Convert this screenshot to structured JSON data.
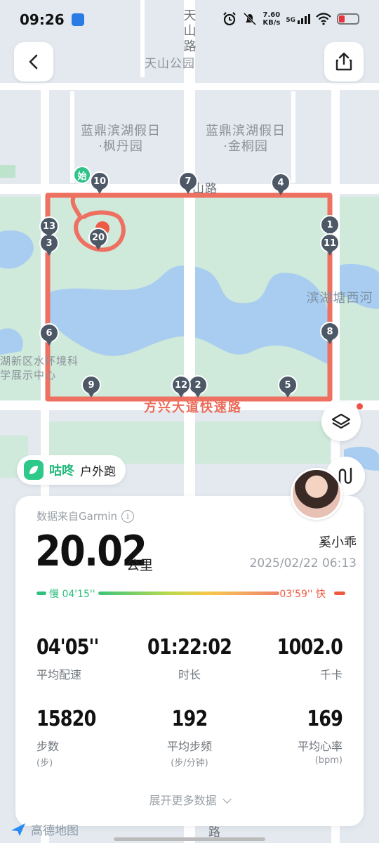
{
  "status_bar": {
    "time": "09:26",
    "net_speed_value": "7.60",
    "net_speed_unit": "KB/s",
    "network": "5G"
  },
  "map": {
    "labels": {
      "tianshan_road": "天山路",
      "tianshan_park": "天山公园",
      "fengdan": "蓝鼎滨湖假日·枫丹园",
      "jintong": "蓝鼎滨湖假日·金桐园",
      "north_road": "山路",
      "binhu_river": "滨湖塘西河",
      "exhibition": "湖新区水环境科学展示中心",
      "expressway": "方兴大道快速路",
      "bottom_road": "路",
      "start": "始"
    },
    "markers": [
      "1",
      "2",
      "3",
      "4",
      "5",
      "6",
      "7",
      "8",
      "9",
      "10",
      "11",
      "12",
      "13",
      "20"
    ],
    "route_color": "#ee7060"
  },
  "brand": {
    "name": "咕咚",
    "activity_type": "户外跑"
  },
  "summary": {
    "source_text": "数据来自Garmin",
    "distance": "20.02",
    "distance_unit": "公里",
    "user_name": "奚小乖",
    "datetime": "2025/02/22 06:13",
    "pace_slow_label": "慢 04'15''",
    "pace_fast_label": "03'59'' 快"
  },
  "stats": [
    {
      "value": "04'05''",
      "label": "平均配速",
      "sub": ""
    },
    {
      "value": "01:22:02",
      "label": "时长",
      "sub": ""
    },
    {
      "value": "1002.0",
      "label": "千卡",
      "sub": ""
    },
    {
      "value": "15820",
      "label": "步数",
      "sub": "(步)"
    },
    {
      "value": "192",
      "label": "平均步频",
      "sub": "(步/分钟)"
    },
    {
      "value": "169",
      "label": "平均心率",
      "sub": "(bpm)"
    }
  ],
  "expand_label": "展开更多数据",
  "map_provider": "高德地图",
  "colors": {
    "accent_green": "#2fc38a",
    "fast_red": "#ef5a3f",
    "marker_gray": "#4d5866"
  }
}
